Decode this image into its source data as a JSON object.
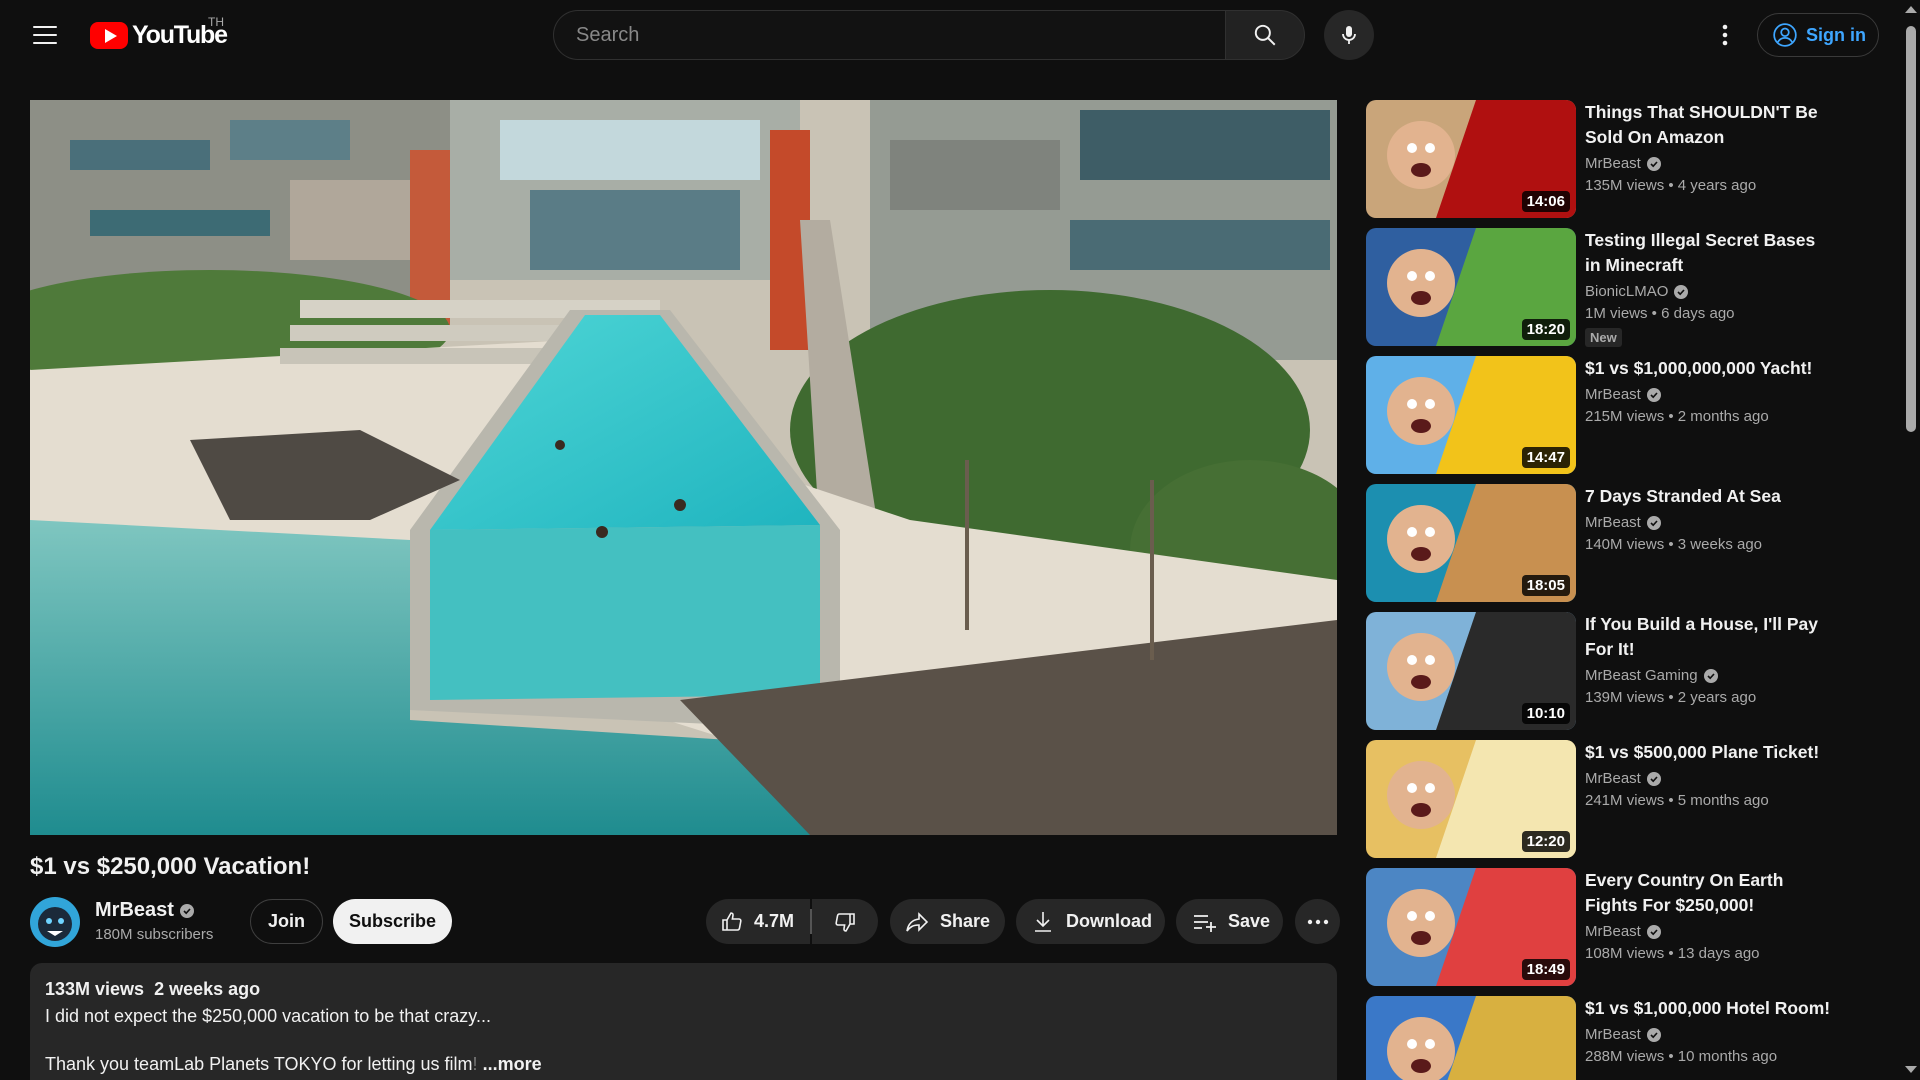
{
  "header": {
    "logo_text": "YouTube",
    "country_code": "TH",
    "search_placeholder": "Search",
    "sign_in_label": "Sign in",
    "icons": [
      "menu-icon",
      "youtube-logo-icon",
      "search-icon",
      "microphone-icon",
      "more-vert-icon",
      "account-circle-icon"
    ]
  },
  "video": {
    "title": "$1 vs $250,000 Vacation!",
    "channel": "MrBeast",
    "subscribers": "180M subscribers",
    "join_label": "Join",
    "subscribe_label": "Subscribe",
    "likes": "4.7M",
    "share_label": "Share",
    "download_label": "Download",
    "save_label": "Save",
    "views": "133M views",
    "uploaded": "2 weeks ago",
    "description_line1": "I did not expect the $250,000 vacation to be that crazy...",
    "description_line2_visible": "Thank you teamLab Planets TOKYO for letting us film",
    "description_line2_fade": "!",
    "more_label": "...more"
  },
  "recommendations": [
    {
      "title": "Things That SHOULDN'T Be Sold On Amazon",
      "channel": "MrBeast",
      "views": "135M views",
      "age": "4 years ago",
      "duration": "14:06",
      "badge": "",
      "thumb_colors": [
        "#c9a57a",
        "#b01010"
      ]
    },
    {
      "title": "Testing Illegal Secret Bases in Minecraft",
      "channel": "BionicLMAO",
      "views": "1M views",
      "age": "6 days ago",
      "duration": "18:20",
      "badge": "New",
      "thumb_colors": [
        "#2f5fa0",
        "#5aa640"
      ]
    },
    {
      "title": "$1 vs $1,000,000,000 Yacht!",
      "channel": "MrBeast",
      "views": "215M views",
      "age": "2 months ago",
      "duration": "14:47",
      "badge": "",
      "thumb_colors": [
        "#5fb0e8",
        "#f2c31a"
      ]
    },
    {
      "title": "7 Days Stranded At Sea",
      "channel": "MrBeast",
      "views": "140M views",
      "age": "3 weeks ago",
      "duration": "18:05",
      "badge": "",
      "thumb_colors": [
        "#1c8fb0",
        "#c89050"
      ]
    },
    {
      "title": "If You Build a House, I'll Pay For It!",
      "channel": "MrBeast Gaming",
      "views": "139M views",
      "age": "2 years ago",
      "duration": "10:10",
      "badge": "",
      "thumb_colors": [
        "#7fb2d8",
        "#2a2a2a"
      ]
    },
    {
      "title": "$1 vs $500,000 Plane Ticket!",
      "channel": "MrBeast",
      "views": "241M views",
      "age": "5 months ago",
      "duration": "12:20",
      "badge": "",
      "thumb_colors": [
        "#e7c062",
        "#f4e6b0"
      ]
    },
    {
      "title": "Every Country On Earth Fights For $250,000!",
      "channel": "MrBeast",
      "views": "108M views",
      "age": "13 days ago",
      "duration": "18:49",
      "badge": "",
      "thumb_colors": [
        "#4c86c4",
        "#e04040"
      ]
    },
    {
      "title": "$1 vs $1,000,000 Hotel Room!",
      "channel": "MrBeast",
      "views": "288M views",
      "age": "10 months ago",
      "duration": "",
      "badge": "",
      "thumb_colors": [
        "#3a78c8",
        "#d8b040"
      ]
    }
  ]
}
